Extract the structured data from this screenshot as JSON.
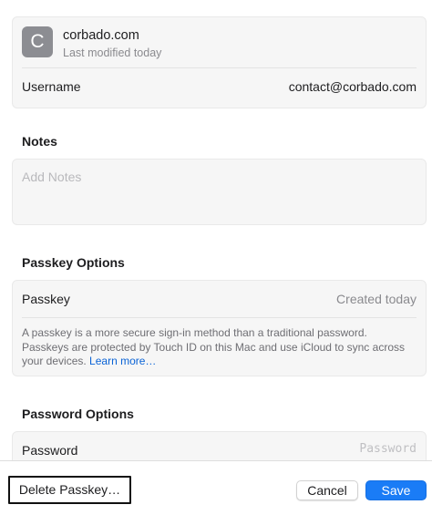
{
  "account": {
    "avatar_letter": "C",
    "site": "corbado.com",
    "modified": "Last modified today",
    "username_label": "Username",
    "username_value": "contact@corbado.com"
  },
  "notes": {
    "title": "Notes",
    "placeholder": "Add Notes",
    "value": ""
  },
  "passkey_options": {
    "title": "Passkey Options",
    "label": "Passkey",
    "value": "Created today",
    "description": "A passkey is a more secure sign-in method than a traditional password. Passkeys are protected by Touch ID on this Mac and use iCloud to sync across your devices.",
    "learn_more": "Learn more…"
  },
  "password_options": {
    "title": "Password Options",
    "label": "Password",
    "placeholder": "Password",
    "value": ""
  },
  "toolbar": {
    "delete_label": "Delete Passkey…",
    "cancel_label": "Cancel",
    "save_label": "Save"
  },
  "colors": {
    "accent": "#1a7cf6",
    "link": "#0a63d6",
    "avatar": "#8c8d92"
  }
}
